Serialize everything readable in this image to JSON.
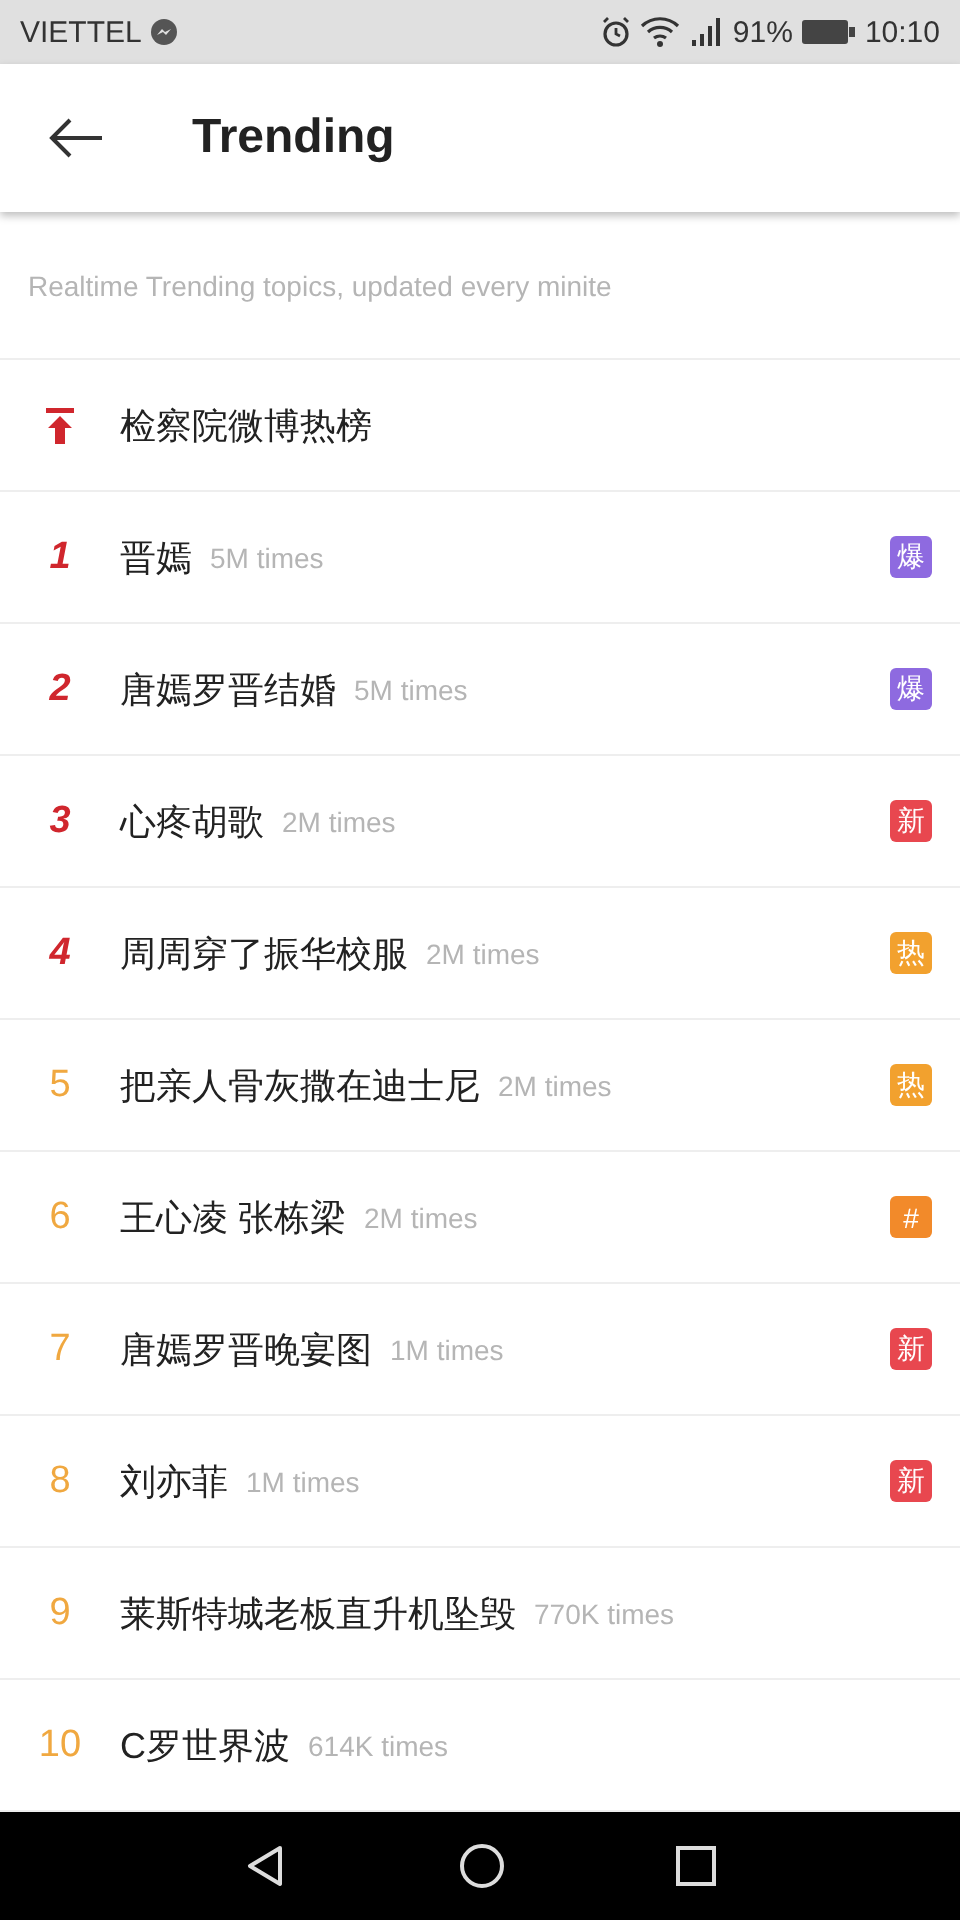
{
  "status_bar": {
    "carrier": "VIETTEL",
    "battery_text": "91%",
    "time": "10:10"
  },
  "header": {
    "title": "Trending"
  },
  "subtitle": "Realtime Trending topics, updated every minite",
  "topics": [
    {
      "kind": "pinned",
      "title": "检察院微博热榜"
    },
    {
      "kind": "top",
      "rank": "1",
      "title": "晋嫣",
      "count": "5M times",
      "badge": {
        "text": "爆",
        "color": "#8e6ae0"
      }
    },
    {
      "kind": "top",
      "rank": "2",
      "title": "唐嫣罗晋结婚",
      "count": "5M times",
      "badge": {
        "text": "爆",
        "color": "#8e6ae0"
      }
    },
    {
      "kind": "top",
      "rank": "3",
      "title": "心疼胡歌",
      "count": "2M times",
      "badge": {
        "text": "新",
        "color": "#e8474f"
      }
    },
    {
      "kind": "top",
      "rank": "4",
      "title": "周周穿了振华校服",
      "count": "2M times",
      "badge": {
        "text": "热",
        "color": "#f2a12e"
      }
    },
    {
      "kind": "regular",
      "rank": "5",
      "title": "把亲人骨灰撒在迪士尼",
      "count": "2M times",
      "badge": {
        "text": "热",
        "color": "#f2a12e"
      }
    },
    {
      "kind": "regular",
      "rank": "6",
      "title": "王心凌 张栋梁",
      "count": "2M times",
      "badge": {
        "text": "#",
        "color": "#f28a2a"
      }
    },
    {
      "kind": "regular",
      "rank": "7",
      "title": "唐嫣罗晋晚宴图",
      "count": "1M times",
      "badge": {
        "text": "新",
        "color": "#e8474f"
      }
    },
    {
      "kind": "regular",
      "rank": "8",
      "title": "刘亦菲",
      "count": "1M times",
      "badge": {
        "text": "新",
        "color": "#e8474f"
      }
    },
    {
      "kind": "regular",
      "rank": "9",
      "title": "莱斯特城老板直升机坠毁",
      "count": "770K times"
    },
    {
      "kind": "regular",
      "rank": "10",
      "title": "C罗世界波",
      "count": "614K times"
    }
  ]
}
